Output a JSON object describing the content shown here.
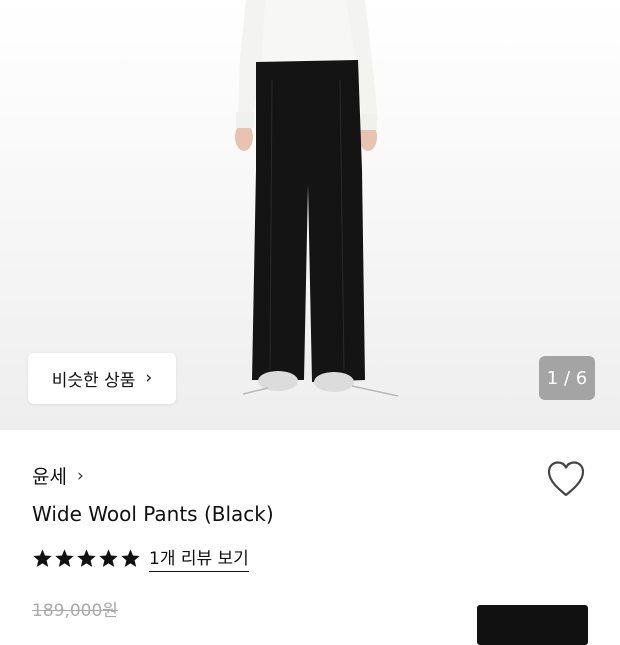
{
  "hero": {
    "similar_button_label": "비슷한 상품",
    "similar_button_chevron": "›",
    "image_counter": "1 / 6"
  },
  "product": {
    "brand": "윤세",
    "brand_chevron": "›",
    "title": "Wide Wool Pants (Black)",
    "rating_stars": 5,
    "review_link": "1개 리뷰 보기",
    "original_price": "189,000원"
  },
  "icons": {
    "favorite": "heart-outline-icon",
    "star": "star-filled-icon"
  },
  "colors": {
    "text": "#111111",
    "muted": "#aaaaaa",
    "counter_bg": "#969696"
  }
}
